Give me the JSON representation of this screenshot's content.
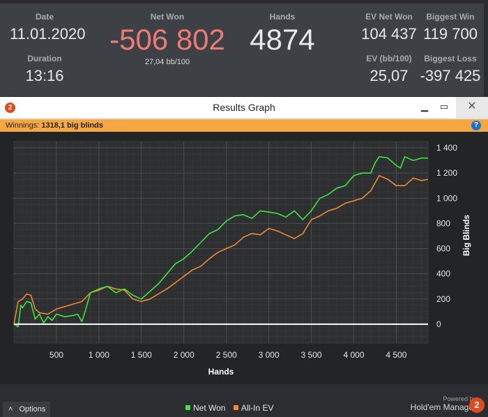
{
  "stats": {
    "date": {
      "label": "Date",
      "value": "11.01.2020"
    },
    "duration": {
      "label": "Duration",
      "value": "13:16"
    },
    "net_won": {
      "label": "Net Won",
      "value": "-506 802",
      "sub": "27,04 bb/100"
    },
    "hands": {
      "label": "Hands",
      "value": "4874"
    },
    "ev_net_won": {
      "label": "EV Net Won",
      "value": "104 437"
    },
    "ev_bb100": {
      "label": "EV (bb/100)",
      "value": "25,07"
    },
    "biggest_win": {
      "label": "Biggest Win",
      "value": "119 700"
    },
    "biggest_loss": {
      "label": "Biggest Loss",
      "value": "-397 425"
    }
  },
  "window": {
    "title": "Results Graph",
    "app_icon": "2",
    "minimize": "▁",
    "maximize": "▭",
    "close": "✕",
    "winnings_label": "Winnings:",
    "winnings_value": "1318,1 big blinds",
    "help": "?",
    "options_label": "Options",
    "options_icon": "chevron-up-icon",
    "powered_by": "Powered by",
    "brand_name": "Hold'em Manager",
    "brand_logo": "2"
  },
  "colors": {
    "net_won_red": "#ef7b76",
    "net_won_line": "#3ee63e",
    "all_in_ev_line": "#f08a30",
    "zero_line": "#ffffff",
    "winnings_bar": "#f5a841"
  },
  "chart_data": {
    "type": "line",
    "xlabel": "Hands",
    "ylabel": "Big Blinds",
    "xlim": [
      0,
      4874
    ],
    "ylim": [
      -150,
      1450
    ],
    "xticks": [
      500,
      1000,
      1500,
      2000,
      2500,
      3000,
      3500,
      4000,
      4500
    ],
    "xtick_labels": [
      "500",
      "1 000",
      "1 500",
      "2 000",
      "2 500",
      "3 000",
      "3 500",
      "4 000",
      "4 500"
    ],
    "yticks": [
      0,
      200,
      400,
      600,
      800,
      1000,
      1200,
      1400
    ],
    "ytick_labels": [
      "0",
      "200",
      "400",
      "600",
      "800",
      "1 000",
      "1 200",
      "1 400"
    ],
    "grid": true,
    "legend_position": "bottom",
    "series": [
      {
        "name": "Net Won",
        "color": "#3ee63e",
        "x": [
          0,
          50,
          80,
          100,
          150,
          200,
          250,
          300,
          350,
          400,
          450,
          500,
          600,
          700,
          750,
          800,
          850,
          900,
          1000,
          1100,
          1200,
          1300,
          1400,
          1500,
          1600,
          1700,
          1800,
          1900,
          2000,
          2100,
          2200,
          2300,
          2400,
          2500,
          2600,
          2700,
          2800,
          2900,
          3000,
          3100,
          3200,
          3300,
          3400,
          3500,
          3600,
          3700,
          3800,
          3900,
          4000,
          4100,
          4200,
          4250,
          4300,
          4400,
          4500,
          4550,
          4600,
          4700,
          4800,
          4874
        ],
        "y": [
          0,
          -20,
          150,
          130,
          180,
          170,
          40,
          80,
          10,
          60,
          30,
          80,
          60,
          70,
          80,
          20,
          130,
          250,
          280,
          300,
          250,
          280,
          230,
          200,
          260,
          320,
          400,
          480,
          520,
          580,
          650,
          720,
          750,
          820,
          860,
          870,
          840,
          900,
          890,
          880,
          850,
          900,
          830,
          900,
          1000,
          1030,
          1080,
          1100,
          1180,
          1200,
          1200,
          1280,
          1330,
          1320,
          1260,
          1240,
          1330,
          1300,
          1320,
          1318
        ]
      },
      {
        "name": "All-In EV",
        "color": "#f08a30",
        "x": [
          0,
          50,
          100,
          150,
          200,
          250,
          300,
          400,
          500,
          600,
          700,
          800,
          900,
          1000,
          1100,
          1200,
          1300,
          1400,
          1500,
          1600,
          1700,
          1800,
          1900,
          2000,
          2100,
          2200,
          2300,
          2400,
          2500,
          2600,
          2700,
          2800,
          2900,
          3000,
          3100,
          3200,
          3300,
          3400,
          3500,
          3600,
          3700,
          3800,
          3900,
          4000,
          4100,
          4200,
          4300,
          4400,
          4500,
          4600,
          4700,
          4800,
          4874
        ],
        "y": [
          0,
          180,
          200,
          240,
          230,
          120,
          90,
          80,
          120,
          140,
          160,
          180,
          250,
          270,
          300,
          280,
          270,
          200,
          180,
          200,
          240,
          280,
          330,
          380,
          430,
          460,
          520,
          570,
          600,
          630,
          690,
          720,
          710,
          760,
          740,
          710,
          680,
          720,
          830,
          860,
          900,
          920,
          960,
          980,
          1000,
          1060,
          1180,
          1150,
          1100,
          1100,
          1160,
          1140,
          1150
        ]
      }
    ]
  }
}
